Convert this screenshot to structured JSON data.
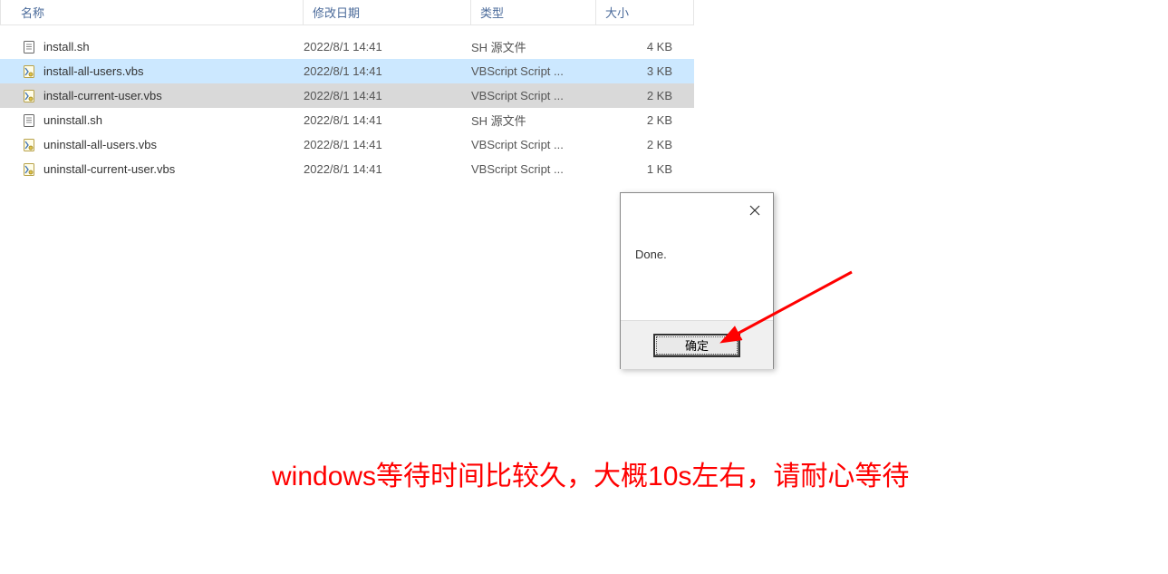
{
  "columns": {
    "name": "名称",
    "date": "修改日期",
    "type": "类型",
    "size": "大小"
  },
  "files": [
    {
      "icon": "text",
      "name": "install.sh",
      "date": "2022/8/1 14:41",
      "type": "SH 源文件",
      "size": "4 KB",
      "state": ""
    },
    {
      "icon": "vbs",
      "name": "install-all-users.vbs",
      "date": "2022/8/1 14:41",
      "type": "VBScript Script ...",
      "size": "3 KB",
      "state": "highlighted"
    },
    {
      "icon": "vbs",
      "name": "install-current-user.vbs",
      "date": "2022/8/1 14:41",
      "type": "VBScript Script ...",
      "size": "2 KB",
      "state": "selected"
    },
    {
      "icon": "text",
      "name": "uninstall.sh",
      "date": "2022/8/1 14:41",
      "type": "SH 源文件",
      "size": "2 KB",
      "state": ""
    },
    {
      "icon": "vbs",
      "name": "uninstall-all-users.vbs",
      "date": "2022/8/1 14:41",
      "type": "VBScript Script ...",
      "size": "2 KB",
      "state": ""
    },
    {
      "icon": "vbs",
      "name": "uninstall-current-user.vbs",
      "date": "2022/8/1 14:41",
      "type": "VBScript Script ...",
      "size": "1 KB",
      "state": ""
    }
  ],
  "dialog": {
    "message": "Done.",
    "ok": "确定"
  },
  "caption": "windows等待时间比较久，大概10s左右，请耐心等待"
}
